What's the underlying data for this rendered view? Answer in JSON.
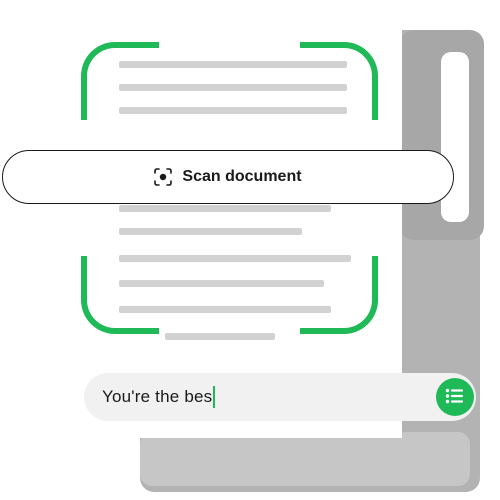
{
  "scan_button": {
    "label": "Scan document",
    "icon": "scan-icon"
  },
  "text_input": {
    "value": "You're the bes"
  },
  "list_button": {
    "icon": "list-icon"
  },
  "colors": {
    "accent": "#1fba57",
    "placeholder_line": "#d2d2d2",
    "back_doc": "#b3b3b3"
  }
}
